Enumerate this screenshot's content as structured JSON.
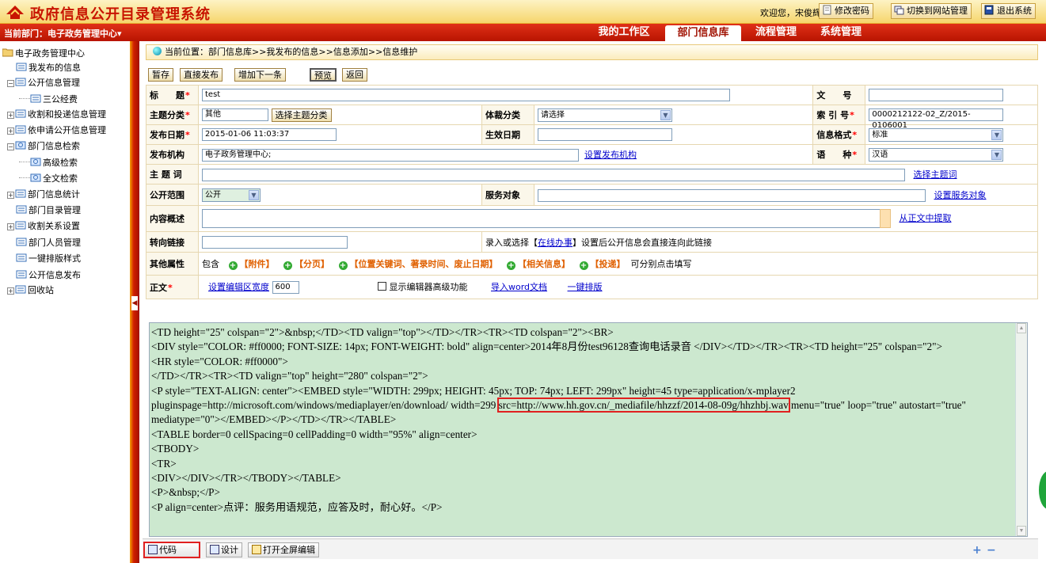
{
  "header": {
    "title": "政府信息公开目录管理系统",
    "welcome": "欢迎您，宋俊辉",
    "change_password": "修改密码",
    "switch_site": "切换到网站管理",
    "logout": "退出系统"
  },
  "navbar": {
    "dept_label": "当前部门：",
    "dept_value": "电子政务管理中心",
    "tabs": [
      {
        "label": "我的工作区",
        "active": false
      },
      {
        "label": "部门信息库",
        "active": true
      },
      {
        "label": "流程管理",
        "active": false
      },
      {
        "label": "系统管理",
        "active": false
      }
    ]
  },
  "sidebar": {
    "items": [
      {
        "label": "电子政务管理中心"
      },
      {
        "label": "我发布的信息"
      },
      {
        "label": "公开信息管理"
      },
      {
        "label": "三公经费"
      },
      {
        "label": "收割和投递信息管理"
      },
      {
        "label": "依申请公开信息管理"
      },
      {
        "label": "部门信息检索"
      },
      {
        "label": "高级检索"
      },
      {
        "label": "全文检索"
      },
      {
        "label": "部门信息统计"
      },
      {
        "label": "部门目录管理"
      },
      {
        "label": "收割关系设置"
      },
      {
        "label": "部门人员管理"
      },
      {
        "label": "一键排版样式"
      },
      {
        "label": "公开信息发布"
      },
      {
        "label": "回收站"
      }
    ]
  },
  "breadcrumb": {
    "prefix": "当前位置：",
    "path": "部门信息库>>我发布的信息>>信息添加>>信息维护"
  },
  "actions": {
    "save_draft": "暂存",
    "publish": "直接发布",
    "add_next": "增加下一条",
    "preview": "预览",
    "back": "返回"
  },
  "form": {
    "title_label": "标　　题",
    "title_value": "test",
    "docno_label": "文　　号",
    "docno_value": "",
    "topic_label": "主题分类",
    "topic_value": "其他",
    "topic_btn": "选择主题分类",
    "genre_label": "体裁分类",
    "genre_value": "请选择",
    "index_label": "索 引 号",
    "index_value": "0000212122-02_Z/2015-0106001",
    "pubdate_label": "发布日期",
    "pubdate_value": "2015-01-06 11:03:37",
    "effdate_label": "生效日期",
    "effdate_value": "",
    "format_label": "信息格式",
    "format_value": "标准",
    "org_label": "发布机构",
    "org_value": "电子政务管理中心;",
    "org_link": "设置发布机构",
    "lang_label": "语　　种",
    "lang_value": "汉语",
    "keyword_label": "主 题 词",
    "keyword_value": "",
    "keyword_link": "选择主题词",
    "scope_label": "公开范围",
    "scope_value": "公开",
    "service_label": "服务对象",
    "service_value": "",
    "service_link": "设置服务对象",
    "summary_label": "内容概述",
    "summary_value": "",
    "summary_link": "从正文中提取",
    "redirect_label": "转向链接",
    "redirect_value": "",
    "redirect_hint_a": "录入或选择【",
    "redirect_hint_link": "在线办事",
    "redirect_hint_b": "】设置后公开信息会直接连向此链接",
    "other_label": "其他属性",
    "other_prefix": "包含",
    "other_items": [
      "【附件】",
      "【分页】",
      "【位置关键词、著录时间、废止日期】",
      "【相关信息】",
      "【投递】"
    ],
    "other_suffix": "可分别点击填写",
    "body_label": "正文",
    "body_width_link": "设置编辑区宽度",
    "body_width_value": "600",
    "advanced_label": "显示编辑器高级功能",
    "import_word": "导入word文档",
    "one_key": "一键排版"
  },
  "editor": {
    "lines": [
      "<TD height=\"25\" colspan=\"2\">&nbsp;</TD><TD valign=\"top\"></TD></TR><TR><TD colspan=\"2\"><BR>",
      "<DIV style=\"COLOR: #ff0000; FONT-SIZE: 14px; FONT-WEIGHT: bold\" align=center>2014年8月份test96128查询电话录音 </DIV></TD></TR><TR><TD height=\"25\" colspan=\"2\">",
      "<HR style=\"COLOR: #ff0000\">",
      "</TD></TR><TR><TD valign=\"top\" height=\"280\" colspan=\"2\">",
      "<P style=\"TEXT-ALIGN: center\"><EMBED style=\"WIDTH: 299px; HEIGHT: 45px; TOP: 74px; LEFT: 299px\" height=45 type=application/x-mplayer2"
    ],
    "line6_a": "pluginspage=http://microsoft.com/windows/mediaplayer/en/download/ width=299 ",
    "line6_hl": "src=http://www.hh.gov.cn/_mediafile/hhzzf/2014-08-09g/hhzhbj.wav",
    "line6_b": " menu=\"true\" loop=\"true\" autostart=\"true\"",
    "lines2": [
      "mediatype=\"0\"></EMBED></P></TD></TR></TABLE>",
      "<TABLE border=0 cellSpacing=0 cellPadding=0 width=\"95%\" align=center>",
      "<TBODY>",
      "<TR>",
      "<DIV></DIV></TR></TBODY></TABLE>",
      "<P>&nbsp;</P>",
      "<P align=center>点评：服务用语规范，应答及时，耐心好。</P>"
    ]
  },
  "bottombar": {
    "code": "代码",
    "design": "设计",
    "fullscreen": "打开全屏编辑"
  },
  "colors": {
    "brand_red": "#c81400",
    "nav_red": "#b81400",
    "editor_bg": "#cce8cf",
    "highlight": "#e02020"
  }
}
